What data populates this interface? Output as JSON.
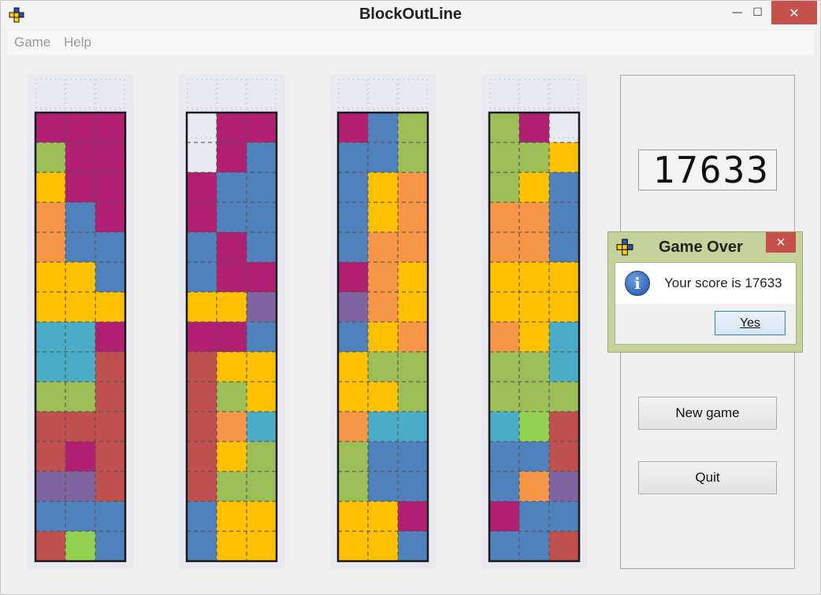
{
  "window": {
    "title": "BlockOutLine",
    "close_glyph": "✕",
    "minimize_glyph": "—",
    "maximize_glyph": "☐"
  },
  "menu": {
    "items": [
      "Game",
      "Help"
    ]
  },
  "score_display": "17633",
  "buttons": {
    "new_game": "New game",
    "quit": "Quit"
  },
  "dialog": {
    "title": "Game Over",
    "message": "Your score is 17633",
    "yes_label": "Yes",
    "close_glyph": "✕",
    "icon": "info-icon"
  },
  "colors": {
    "M": "#b01f72",
    "G": "#9bbf56",
    "Y": "#ffc000",
    "O": "#f79646",
    "B": "#4f81bd",
    "C": "#4aacc6",
    "R": "#c0504d",
    "P": "#8064a2",
    "L": "#92d050",
    "well": "#e9e9f1",
    "outline": "#1a1a1a",
    "dash": "#555555"
  },
  "boards": [
    {
      "name": "column-1",
      "height": 15,
      "grid": [
        "MMM",
        "GMM",
        "YMM",
        "OBM",
        "OBB",
        "YYB",
        "YYY",
        "CCM",
        "CCR",
        "GGR",
        "RRR",
        "RMR",
        "PPR",
        "BBB",
        "RLB"
      ]
    },
    {
      "name": "column-2",
      "height": 13,
      "grid": [
        "MB",
        "BB",
        "BB",
        "MB",
        "MM",
        "YYP",
        "MMB",
        "RYY",
        "RGY",
        "ROC",
        "RYG",
        "RGG",
        "BYY",
        "BYY"
      ],
      "grid_full": [
        ".MM",
        ".MB",
        "MBB",
        "MBB",
        "BMB",
        "BMM",
        "YYP",
        "MMB",
        "RYY",
        "RGY",
        "ROC",
        "RYG",
        "RGG",
        "BYY",
        "BYY"
      ]
    },
    {
      "name": "column-3",
      "height": 15,
      "grid": [
        "MBG",
        "BBG",
        "BYO",
        "BYO",
        "BOO",
        "MOY",
        "POY",
        "BYO",
        "YGG",
        "YYG",
        "OCC",
        "GBB",
        "GBB",
        "YYM",
        "YYB"
      ]
    },
    {
      "name": "column-4",
      "height": 15,
      "grid": [
        "GM.",
        "GGY",
        "GYB",
        "OOB",
        "OOB",
        "YYY",
        "YYY",
        "OYC",
        "GGC",
        "GGG",
        "CLR",
        "BBR",
        "BOP",
        "MBB",
        "BBR"
      ]
    }
  ]
}
